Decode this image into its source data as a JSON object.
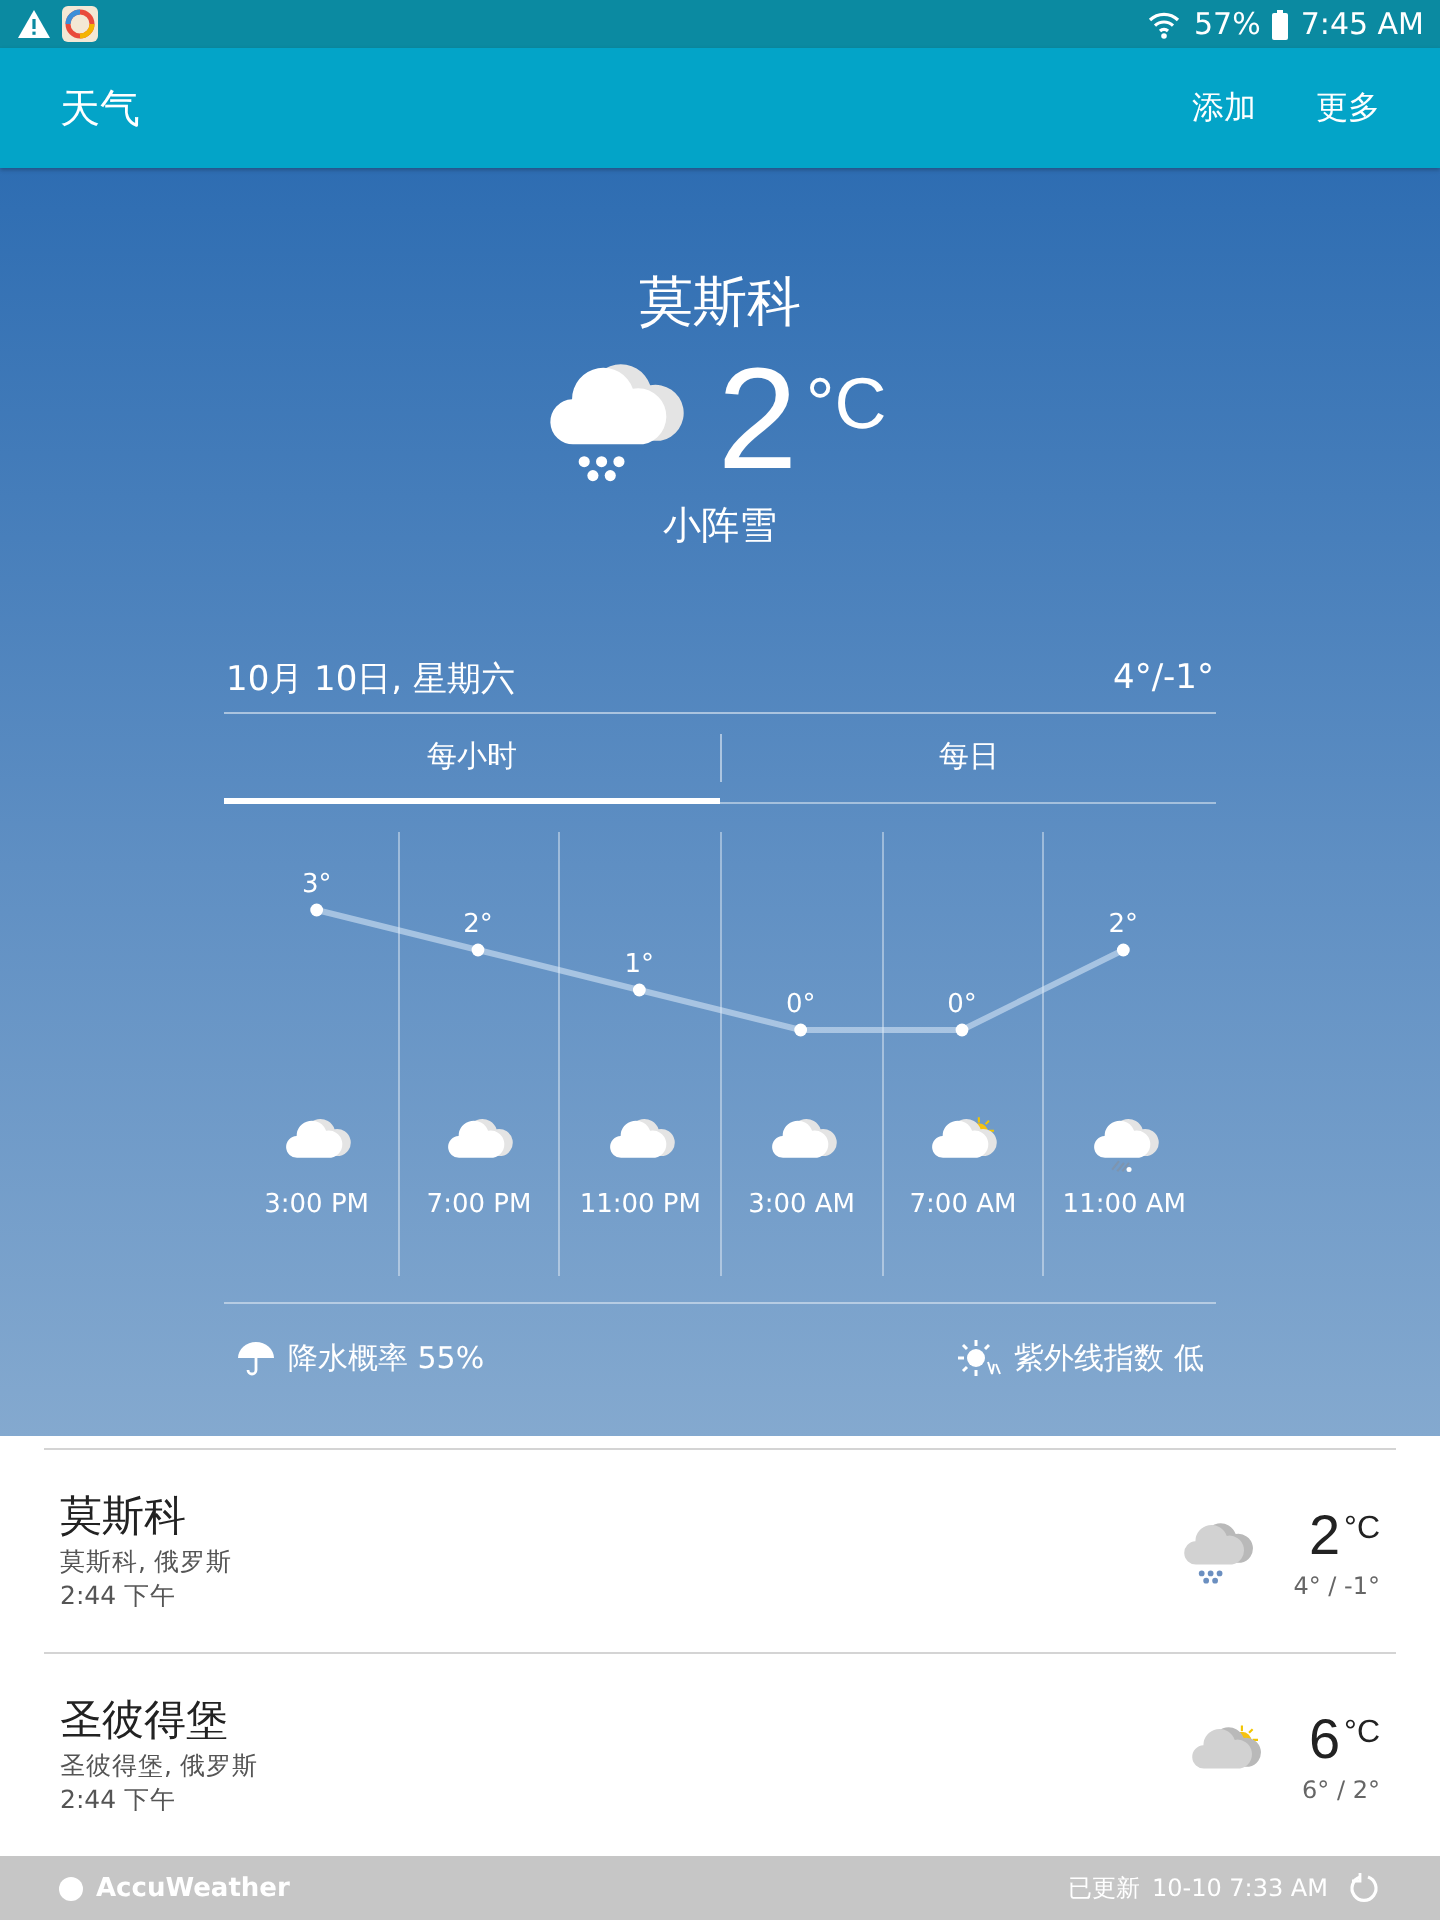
{
  "status_bar": {
    "battery": "57%",
    "time": "7:45 AM"
  },
  "app_bar": {
    "title": "天气",
    "actions": [
      "添加",
      "更多"
    ]
  },
  "current": {
    "city": "莫斯科",
    "kind": "snow",
    "temperature": "2",
    "unit": "°C",
    "condition": "小阵雪"
  },
  "day": {
    "date": "10月 10日, 星期六",
    "range": "4°/-1°"
  },
  "tabs": [
    {
      "label": "每小时",
      "selected": true
    },
    {
      "label": "每日",
      "selected": false
    }
  ],
  "hourly": {
    "chart_data": {
      "type": "line",
      "marker": true,
      "categories": [
        "3:00 PM",
        "7:00 PM",
        "11:00 PM",
        "3:00 AM",
        "7:00 AM",
        "11:00 AM"
      ],
      "values": [
        3,
        2,
        1,
        0,
        0,
        2
      ],
      "value_labels": [
        "3°",
        "2°",
        "1°",
        "0°",
        "0°",
        "2°"
      ]
    },
    "icons": [
      {
        "kind": "cloud"
      },
      {
        "kind": "cloud"
      },
      {
        "kind": "cloud"
      },
      {
        "kind": "cloud"
      },
      {
        "kind": "sun"
      },
      {
        "kind": "sleet"
      }
    ]
  },
  "precipitation": "降水概率 55%",
  "uv_index": "紫外线指数 低",
  "cities": [
    {
      "name": "莫斯科",
      "region": "莫斯科, 俄罗斯",
      "local_time": "2:44 下午",
      "kind": "snow",
      "temperature": "2",
      "unit": "°C",
      "range": "4° / -1°"
    },
    {
      "name": "圣彼得堡",
      "region": "圣彼得堡, 俄罗斯",
      "local_time": "2:44 下午",
      "kind": "sun",
      "temperature": "6",
      "unit": "°C",
      "range": "6° / 2°"
    }
  ],
  "footer": {
    "brand": "AccuWeather",
    "updated_label": "已更新",
    "updated_time": "10-10 7:33 AM"
  }
}
